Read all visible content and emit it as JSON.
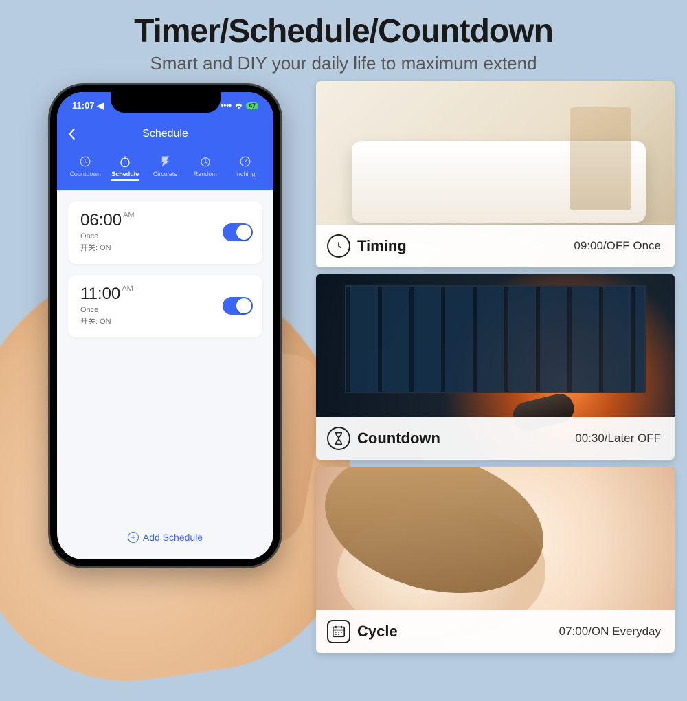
{
  "header": {
    "title": "Timer/Schedule/Countdown",
    "subtitle": "Smart and DIY your daily life to maximum extend"
  },
  "phone": {
    "status": {
      "time": "11:07",
      "battery": "47"
    },
    "nav": {
      "title": "Schedule"
    },
    "tabs": [
      {
        "label": "Countdown"
      },
      {
        "label": "Schedule"
      },
      {
        "label": "Circulate"
      },
      {
        "label": "Random"
      },
      {
        "label": "Inching"
      }
    ],
    "active_tab": 1,
    "items": [
      {
        "time": "06:00",
        "ampm": "AM",
        "repeat": "Once",
        "detail": "开关: ON",
        "on": true
      },
      {
        "time": "11:00",
        "ampm": "AM",
        "repeat": "Once",
        "detail": "开关: ON",
        "on": true
      }
    ],
    "add_label": "Add Schedule"
  },
  "scenarios": [
    {
      "icon": "clock",
      "title": "Timing",
      "value": "09:00/OFF Once"
    },
    {
      "icon": "hourglass",
      "title": "Countdown",
      "value": "00:30/Later OFF"
    },
    {
      "icon": "calendar",
      "title": "Cycle",
      "value": "07:00/ON Everyday"
    }
  ]
}
